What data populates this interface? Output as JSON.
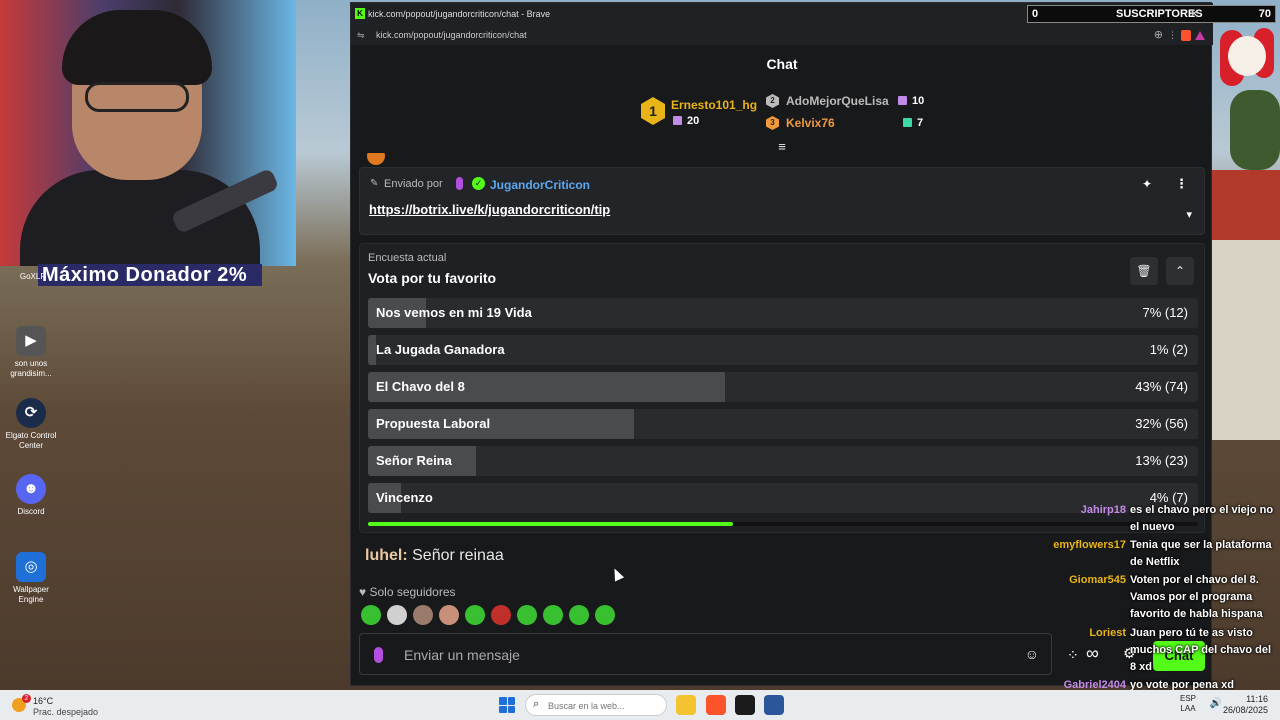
{
  "overlay": {
    "donor_banner": "Máximo Donador 2%",
    "subscribers": {
      "current": "0",
      "label": "SUSCRIPTORES",
      "close": "×",
      "goal": "70"
    }
  },
  "desktop_icons": [
    {
      "label": "GoXLR"
    },
    {
      "label": "son unos grandisim..."
    },
    {
      "label": "Elgato Control Center"
    },
    {
      "label": "Discord"
    },
    {
      "label": "Wallpaper Engine"
    }
  ],
  "browser": {
    "title": "kick.com/popout/jugandorcriticon/chat - Brave",
    "url": "kick.com/popout/jugandorcriticon/chat"
  },
  "chat": {
    "header": "Chat",
    "leaderboard": [
      {
        "rank": "1",
        "name": "Ernesto101_hg",
        "count": "20",
        "name_color": "#e8b418",
        "gift_color": "#c38be8"
      },
      {
        "rank": "2",
        "name": "AdoMejorQueLisa",
        "count": "10",
        "name_color": "#bbbbbb",
        "gift_color": "#c38be8"
      },
      {
        "rank": "3",
        "name": "Kelvix76",
        "count": "7",
        "name_color": "#f09a3c",
        "gift_color": "#3fd8a8"
      }
    ],
    "pinned": {
      "sent_by": "Enviado por",
      "sender": "JugandorCriticon",
      "link": "https://botrix.live/k/jugandorcriticon/tip"
    },
    "poll": {
      "caption": "Encuesta actual",
      "question": "Vota por tu favorito",
      "options": [
        {
          "label": "Nos vemos en mi 19 Vida",
          "percent": 7,
          "result": "7% (12)"
        },
        {
          "label": "La Jugada Ganadora",
          "percent": 1,
          "result": "1% (2)"
        },
        {
          "label": "El Chavo del 8",
          "percent": 43,
          "result": "43% (74)"
        },
        {
          "label": "Propuesta Laboral",
          "percent": 32,
          "result": "32% (56)"
        },
        {
          "label": "Señor Reina",
          "percent": 13,
          "result": "13% (23)"
        },
        {
          "label": "Vincenzo",
          "percent": 4,
          "result": "4% (7)"
        }
      ],
      "time_remaining_fraction": 0.44
    },
    "latest_message": {
      "user": "luhel:",
      "text": "Señor reinaa"
    },
    "followers_only": "Solo seguidores",
    "emotes": [
      "#39c030",
      "#d0d0d0",
      "#9a7a6a",
      "#c8907a",
      "#39c030",
      "#c0302a",
      "#39c030",
      "#39c030",
      "#39c030",
      "#39c030"
    ],
    "input_placeholder": "Enviar un mensaje",
    "send_label": "Chat"
  },
  "overlay_chat": [
    {
      "user": "Jahirp18",
      "user_color": "#c38be8",
      "text": "es el chavo pero el viejo no el nuevo"
    },
    {
      "user": "emyflowers17",
      "user_color": "#e8b418",
      "text": "Tenia que ser la plataforma de Netflix"
    },
    {
      "user": "Giomar545",
      "user_color": "#e8b418",
      "text": "Voten por el chavo del 8. Vamos por el programa favorito de habla hispana"
    },
    {
      "user": "Loriest",
      "user_color": "#e8b418",
      "text": "Juan pero tú te as visto muchos CAP del chavo del 8 xd"
    },
    {
      "user": "Gabriel2404",
      "user_color": "#c38be8",
      "text": "yo vote  por pena xd"
    }
  ],
  "taskbar": {
    "weather_badge": "2",
    "weather_temp": "16°C",
    "weather_desc": "Prac. despejado",
    "search_placeholder": "Buscar en la web...",
    "lang": "ESP",
    "lang_region": "LAA",
    "time": "11:16",
    "date": "26/08/2025"
  }
}
